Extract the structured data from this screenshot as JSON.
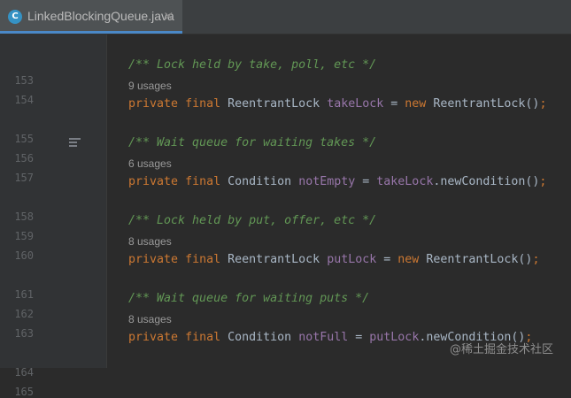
{
  "tab": {
    "file_icon": "C",
    "filename": "LinkedBlockingQueue.java",
    "close": "×"
  },
  "gutter": {
    "lines": [
      "153",
      "154",
      "155",
      "156",
      "157",
      "158",
      "159",
      "160",
      "161",
      "162",
      "163",
      "164",
      "165"
    ]
  },
  "code": {
    "c154": "/** Lock held by take, poll, etc */",
    "u154": "9 usages",
    "l155": {
      "k1": "private",
      "k2": "final",
      "type": "ReentrantLock",
      "field": "takeLock",
      "eq": "=",
      "k3": "new",
      "ctor": "ReentrantLock()",
      "semi": ";"
    },
    "c157": "/** Wait queue for waiting takes */",
    "u157": "6 usages",
    "l158": {
      "k1": "private",
      "k2": "final",
      "type": "Condition",
      "field": "notEmpty",
      "eq": "=",
      "obj": "takeLock",
      "call": ".newCondition()",
      "semi": ";"
    },
    "c160": "/** Lock held by put, offer, etc */",
    "u160": "8 usages",
    "l161": {
      "k1": "private",
      "k2": "final",
      "type": "ReentrantLock",
      "field": "putLock",
      "eq": "=",
      "k3": "new",
      "ctor": "ReentrantLock()",
      "semi": ";"
    },
    "c163": "/** Wait queue for waiting puts */",
    "u163": "8 usages",
    "l164": {
      "k1": "private",
      "k2": "final",
      "type": "Condition",
      "field": "notFull",
      "eq": "=",
      "obj": "putLock",
      "call": ".newCondition()",
      "semi": ";"
    }
  },
  "watermark": "@稀土掘金技术社区",
  "colors": {
    "background": "#2b2b2b",
    "keyword": "#cc7832",
    "comment": "#629755",
    "field": "#9876aa",
    "plain": "#a9b7c6",
    "tab_accent": "#4a88c7"
  }
}
